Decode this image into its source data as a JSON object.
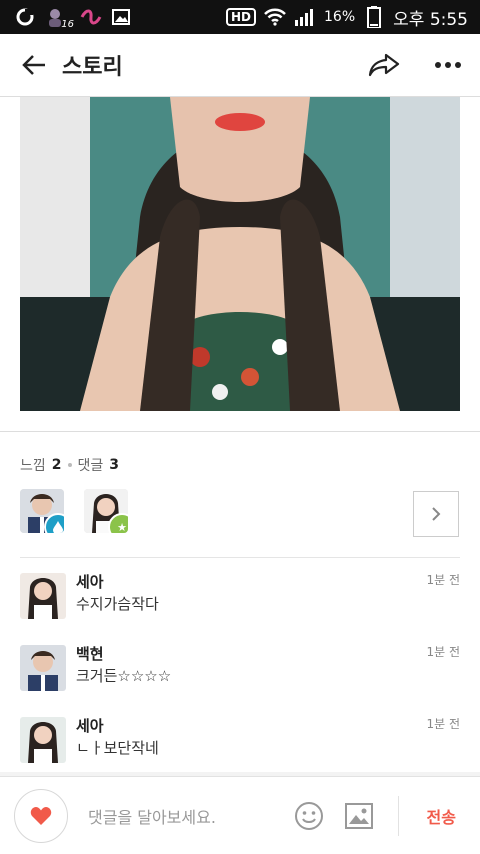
{
  "status_bar": {
    "notification_badge": "16",
    "hd": "HD",
    "battery": "16%",
    "time": "오후 5:55"
  },
  "header": {
    "title": "스토리",
    "back_icon": "arrow-left-icon",
    "share_icon": "share-icon",
    "more_icon": "more-dots-icon"
  },
  "post": {
    "feelings_label": "느낌",
    "feelings_count": "2",
    "comments_label": "댓글",
    "comments_count": "3"
  },
  "reactors": [
    {
      "badge_icon": "water-drop-icon",
      "badge_color": "#1e9fc7"
    },
    {
      "badge_icon": "star-icon",
      "badge_color": "#8bc34a"
    }
  ],
  "comments": [
    {
      "name": "세아",
      "text": "수지가슴작다",
      "time": "1분 전"
    },
    {
      "name": "백현",
      "text": "크거든☆☆☆☆",
      "time": "1분 전"
    },
    {
      "name": "세아",
      "text": "ㄴㅏ보단작네",
      "time": "1분 전"
    }
  ],
  "composer": {
    "placeholder": "댓글을 달아보세요.",
    "send_label": "전송"
  },
  "colors": {
    "accent": "#f15a4a"
  }
}
